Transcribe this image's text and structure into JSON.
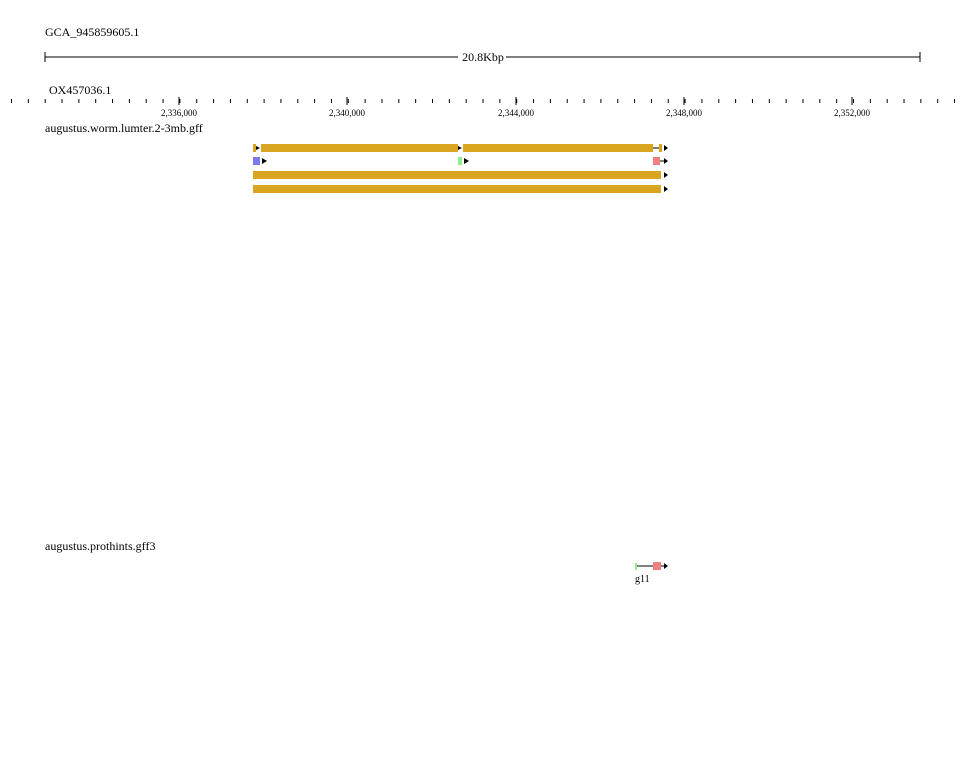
{
  "assembly": "GCA_945859605.1",
  "span_label": "20.8Kbp",
  "chromosome": "OX457036.1",
  "ruler": {
    "tick_labels": [
      "2,336,000",
      "2,340,000",
      "2,344,000",
      "2,348,000",
      "2,352,000"
    ]
  },
  "tracks": [
    {
      "name": "augustus.worm.lumter.2-3mb.gff"
    },
    {
      "name": "augustus.prothints.gff3",
      "feature_label": "g11"
    }
  ],
  "colors": {
    "exon": "#DAA520",
    "start_blue": "#7B7BEE",
    "mid_green": "#90EE90",
    "end_red": "#F08080",
    "line": "#000000"
  }
}
